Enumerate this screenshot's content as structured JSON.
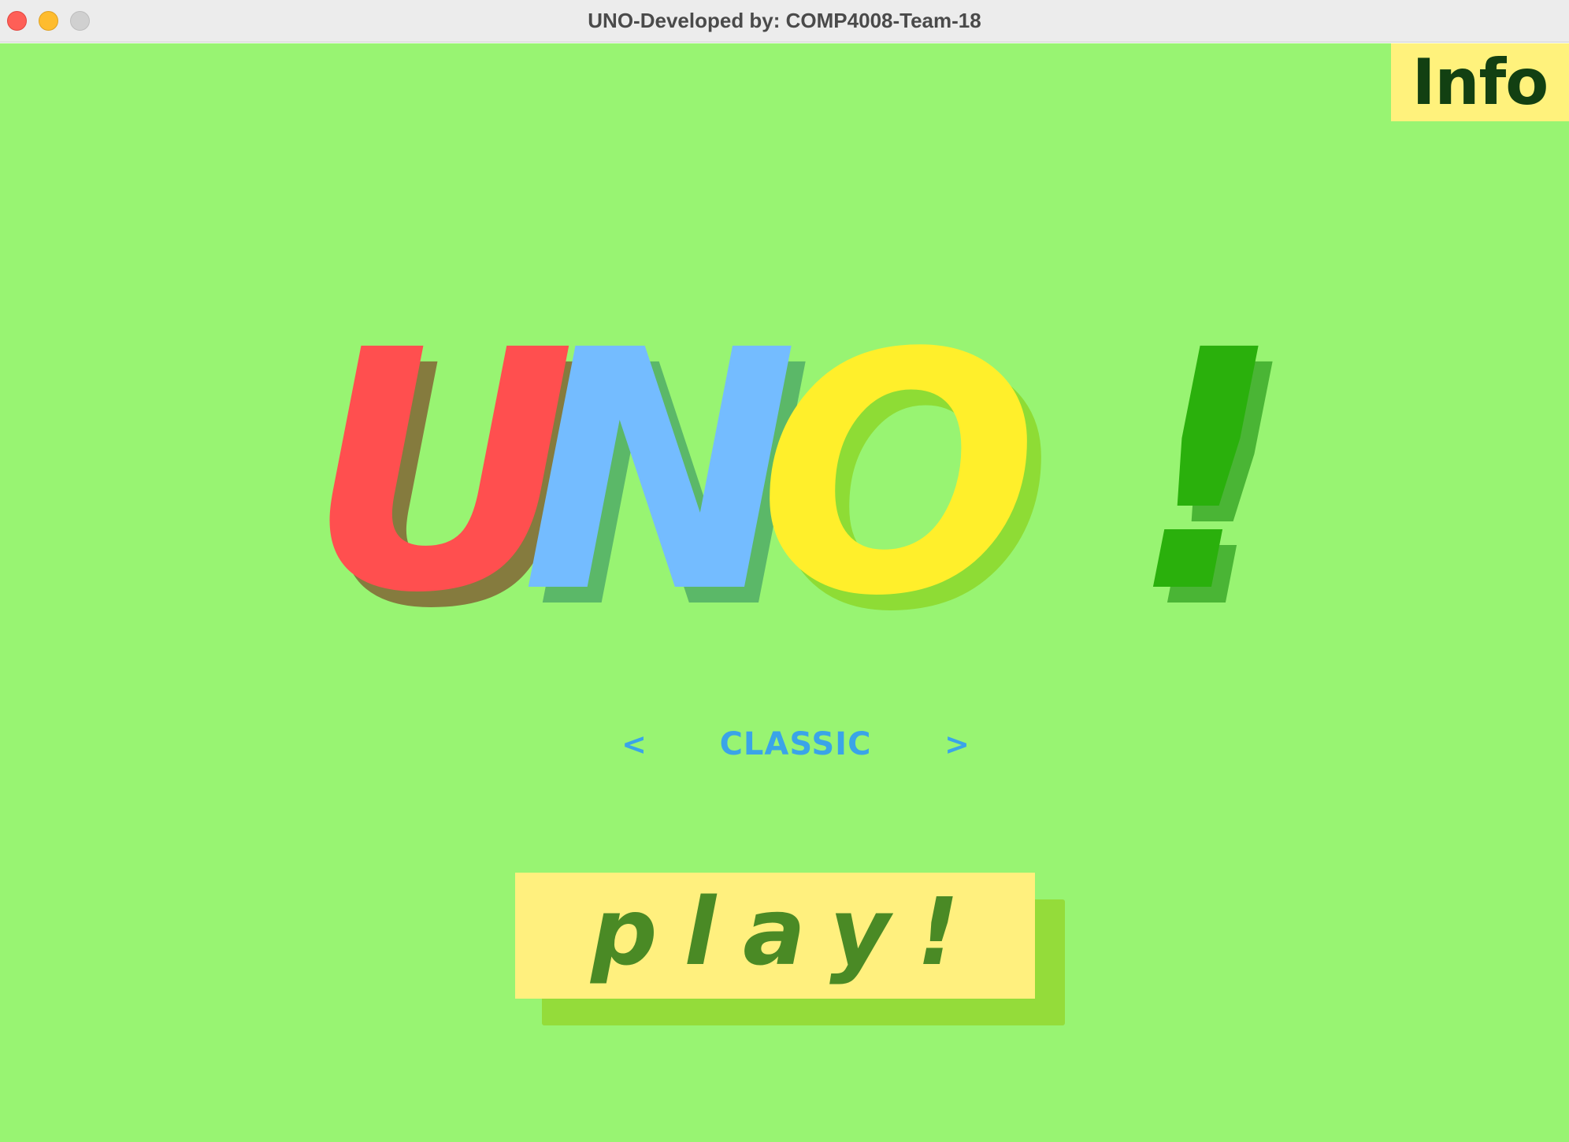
{
  "window": {
    "title": "UNO-Developed by: COMP4008-Team-18"
  },
  "header": {
    "info_label": "Info"
  },
  "logo": {
    "letters": [
      "U",
      "N",
      "O",
      "!"
    ],
    "colors": {
      "u": "#ff4f4f",
      "n": "#74bcff",
      "o": "#ffef2b",
      "exclaim": "#2ab00c",
      "u_shadow": "#857b3e",
      "n_shadow": "#5bb868",
      "o_shadow": "#8edc35",
      "exclaim_shadow": "#4ab535"
    }
  },
  "mode_selector": {
    "prev_icon": "chevron-left-icon",
    "next_icon": "chevron-right-icon",
    "prev_glyph": "<",
    "next_glyph": ">",
    "current_mode": "CLASSIC"
  },
  "play": {
    "label": "play!"
  },
  "theme": {
    "background": "#98f472",
    "button_yellow": "#fff07e",
    "accent_blue": "#3aa4e8",
    "play_text": "#4a8a25"
  }
}
